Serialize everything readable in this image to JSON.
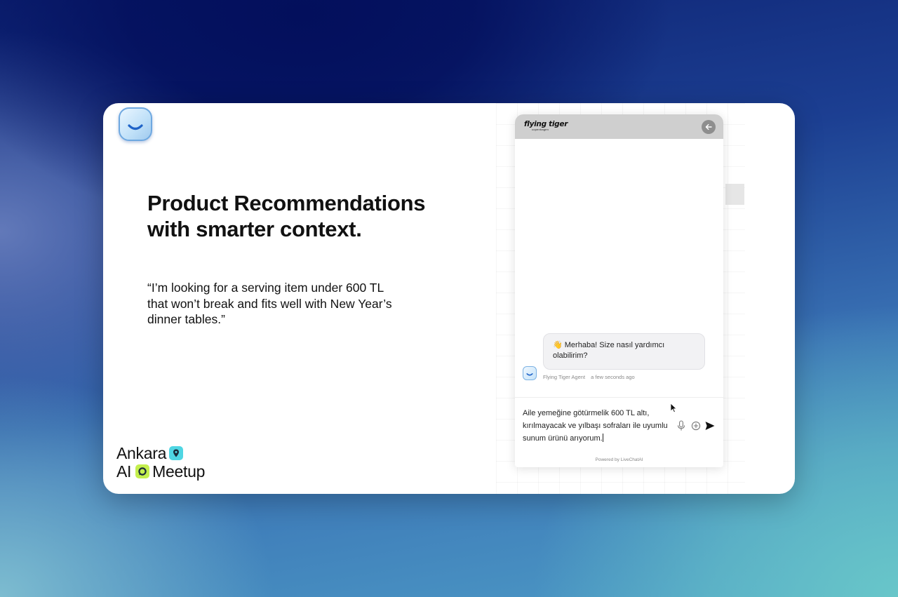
{
  "slide": {
    "headline_line1": "Product Recommendations",
    "headline_line2": "with smarter context.",
    "quote_line1": "“I’m looking for a serving item under 600 TL",
    "quote_line2": "that won’t break and fits well with New Year’s",
    "quote_line3": "dinner tables.”",
    "event_line1": "Ankara",
    "event_line2a": "AI",
    "event_line2b": "Meetup",
    "logo_icon": "smile-icon",
    "accent_colors": {
      "pin_badge": "#4fd6e3",
      "chat_badge": "#c4ef4e"
    }
  },
  "chat_widget": {
    "brand_name": "flying tiger",
    "brand_sub": "copenhagen",
    "back_icon": "arrow-left-icon",
    "messages": [
      {
        "emoji": "👋",
        "text": "Merhaba! Size nasıl yardımcı olabilirim?",
        "sender": "Flying Tiger Agent",
        "time": "a few seconds ago"
      }
    ],
    "input": {
      "line1": "Aile yemeğine götürmelik 600 TL altı,",
      "line2": "kırılmayacak ve yılbaşı sofraları ile uyumlu",
      "line3": "sunum ürünü arıyorum."
    },
    "powered_by": "Powered by LiveChatAI"
  },
  "colors": {
    "header_bg": "#cfcfcf",
    "bubble_bg": "#f2f2f4"
  }
}
